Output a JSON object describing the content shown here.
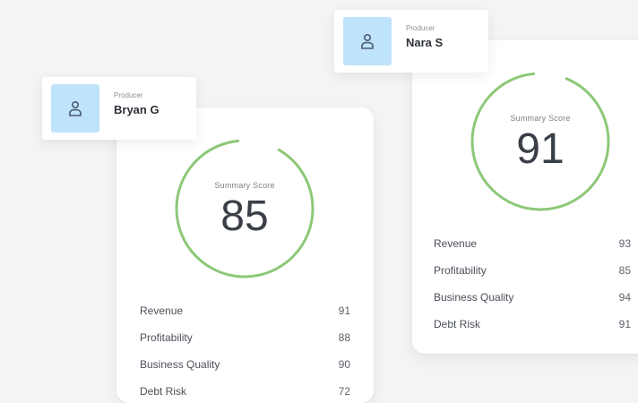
{
  "producers": [
    {
      "role": "Producer",
      "name": "Bryan G",
      "icon": "person-icon",
      "score_label": "Summary Score",
      "score": "85",
      "metrics": [
        {
          "label": "Revenue",
          "value": "91"
        },
        {
          "label": "Profitability",
          "value": "88"
        },
        {
          "label": "Business Quality",
          "value": "90"
        },
        {
          "label": "Debt Risk",
          "value": "72"
        }
      ]
    },
    {
      "role": "Producer",
      "name": "Nara S",
      "icon": "person-icon",
      "score_label": "Summary Score",
      "score": "91",
      "metrics": [
        {
          "label": "Revenue",
          "value": "93"
        },
        {
          "label": "Profitability",
          "value": "85"
        },
        {
          "label": "Business Quality",
          "value": "94"
        },
        {
          "label": "Debt Risk",
          "value": "91"
        }
      ]
    }
  ],
  "colors": {
    "ring": "#8cc878",
    "ring_track": "#ffffff",
    "avatar_bg": "#bfe3fb",
    "avatar_icon": "#4a5a6e"
  }
}
